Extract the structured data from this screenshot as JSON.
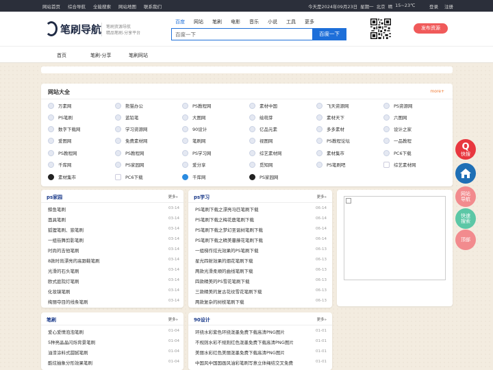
{
  "topbar": {
    "links": [
      "网站首页",
      "综合导航",
      "全能搜索",
      "网站地图",
      "联系我们"
    ],
    "date": "今天是2024年09月23日",
    "weekday": "星期一",
    "city": "北京",
    "weather": "晴",
    "temp": "15~23℃",
    "login": "登录",
    "register": "注册"
  },
  "header": {
    "logo": "笔刷导航",
    "subtitle1": "笔刷资源导航",
    "subtitle2": "精品笔刷-分享平台",
    "search_tabs": [
      "百度",
      "网站",
      "笔刷",
      "电影",
      "音乐",
      "小说",
      "工具",
      "更多"
    ],
    "search_placeholder": "百度一下",
    "search_button": "百度一下",
    "publish_button": "发布资源"
  },
  "nav": {
    "items": [
      "首页",
      "笔刷-分享",
      "笔刷网站"
    ]
  },
  "sites": {
    "title": "网站大全",
    "more": "more+",
    "items": [
      [
        "万素网",
        "熊猫办公",
        "PS教程网",
        "素材中国",
        "飞天资源网",
        "PS资源网"
      ],
      [
        "PS笔刷",
        "蓝铅笔",
        "大图网",
        "绘萌芽",
        "素材天下",
        "六图网"
      ],
      [
        "数字下载网",
        "学习资源网",
        "90设计",
        "亿品元素",
        "多多素材",
        "设计之家"
      ],
      [
        "爱图网",
        "免费素材网",
        "笔刷网",
        "视图网",
        "PS教程论坛",
        "一品教程"
      ],
      [
        "PS教程网",
        "PS教程网",
        "PS学习网",
        "综艺素材网",
        "素材集市",
        "PC6下载"
      ],
      [
        "千库网",
        "PS家园网",
        "爱分享",
        "觅知网",
        "PS笔刷吧",
        "综艺素材网"
      ],
      [
        "素材集市",
        "PC6下载",
        "千库网",
        "PS家园网"
      ]
    ]
  },
  "lists": [
    {
      "title": "ps家园",
      "more": "更多»",
      "rows": [
        [
          "鲸鱼笔刷",
          "03-14"
        ],
        [
          "面具笔刷",
          "03-14"
        ],
        [
          "狐狸笔刷、狼笔刷",
          "03-14"
        ],
        [
          "一组街舞剪影笔刷",
          "03-14"
        ],
        [
          "时尚的吉他笔刷",
          "03-14"
        ],
        [
          "8款时尚漂亮的高跟鞋笔刷",
          "03-14"
        ],
        [
          "光滑的石头笔刷",
          "03-14"
        ],
        [
          "欧式庭院灯笔刷",
          "03-14"
        ],
        [
          "化妆镜笔刷",
          "03-14"
        ],
        [
          "绚丽夺目的线条笔刷",
          "03-14"
        ]
      ]
    },
    {
      "title": "ps学习",
      "more": "更多»",
      "rows": [
        [
          "PS笔刷下载之漂亮马匹笔刷下载",
          "06-14"
        ],
        [
          "PS笔刷下载之梅花鹿笔刷下载",
          "06-14"
        ],
        [
          "PS笔刷下载之梦幻圣诞树笔刷下载",
          "06-14"
        ],
        [
          "PS笔刷下载之精美蔓藤花笔刷下载",
          "06-14"
        ],
        [
          "一组梯作炫光效果的PS笔刷下载",
          "06-13"
        ],
        [
          "星光四射效果的烟花笔刷下载",
          "06-13"
        ],
        [
          "两款光滑柔顺的曲线笔刷下载",
          "06-13"
        ],
        [
          "四款精美的PS雪花笔刷下载",
          "06-13"
        ],
        [
          "三款精美的复古花纹雪花笔刷下载",
          "06-13"
        ],
        [
          "两款复杂的树枝笔刷下载",
          "06-13"
        ]
      ]
    },
    {
      "title": "笔刷",
      "more": "更多»",
      "rows": [
        [
          "爱心爱情泡泡笔刷",
          "01-04"
        ],
        [
          "5种亮晶晶闪烁背景笔刷",
          "01-04"
        ],
        [
          "油漆涂料式甜腻笔刷",
          "01-04"
        ],
        [
          "酷炫抽象分形效果笔刷",
          "01-04"
        ]
      ]
    },
    {
      "title": "90设计",
      "more": "更多»",
      "rows": [
        [
          "环绕水彩紫色环绕泼墨免费下载高清PNG图片",
          "01-01"
        ],
        [
          "不规则水彩不规则红色泼墨免费下载高清PNG图片",
          "01-01"
        ],
        [
          "美丽水彩红色美丽泼墨免费下载高清PNG图片",
          "01-01"
        ],
        [
          "中国风中国国画风油彩笔刷写意立体绳结交叉免费",
          "01-01"
        ]
      ]
    }
  ],
  "float": [
    {
      "label": "快搜",
      "color": "#e8373f"
    },
    {
      "label": "",
      "color": "#1f6fb5"
    },
    {
      "label1": "网站",
      "label2": "导航",
      "color": "#f28b8e"
    },
    {
      "label1": "快速",
      "label2": "搜索",
      "color": "#5cc7a6"
    },
    {
      "label": "顶部",
      "color": "#f28b8e"
    }
  ]
}
